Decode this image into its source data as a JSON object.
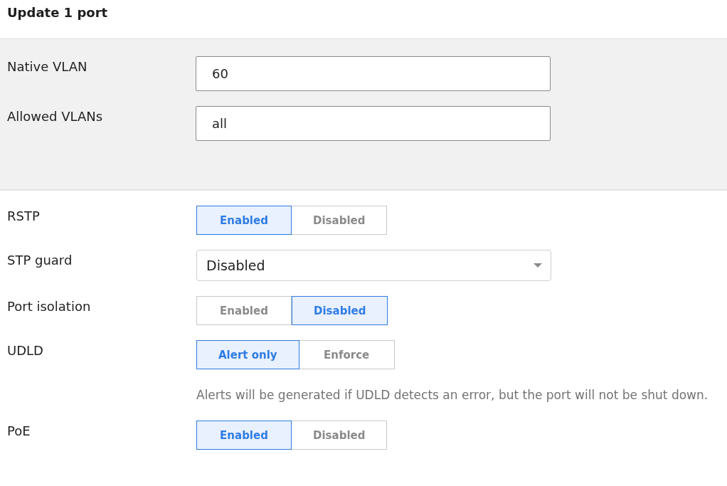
{
  "title": "Update 1 port",
  "vlan_fields": [
    {
      "label": "Native VLAN",
      "value": "60"
    },
    {
      "label": "Allowed VLANs",
      "value": "all"
    }
  ],
  "settings": [
    {
      "label": "RSTP",
      "kind": "toggle",
      "options": [
        {
          "label": "Enabled",
          "selected": true
        },
        {
          "label": "Disabled",
          "selected": false
        }
      ]
    },
    {
      "label": "STP guard",
      "kind": "select",
      "value": "Disabled"
    },
    {
      "label": "Port isolation",
      "kind": "toggle",
      "options": [
        {
          "label": "Enabled",
          "selected": false
        },
        {
          "label": "Disabled",
          "selected": true
        }
      ]
    },
    {
      "label": "UDLD",
      "kind": "toggle",
      "options": [
        {
          "label": "Alert only",
          "selected": true
        },
        {
          "label": "Enforce",
          "selected": false
        }
      ],
      "help": "Alerts will be generated if UDLD detects an error, but the port will not be shut down."
    },
    {
      "label": "PoE",
      "kind": "toggle",
      "options": [
        {
          "label": "Enabled",
          "selected": true
        },
        {
          "label": "Disabled",
          "selected": false
        }
      ]
    }
  ]
}
